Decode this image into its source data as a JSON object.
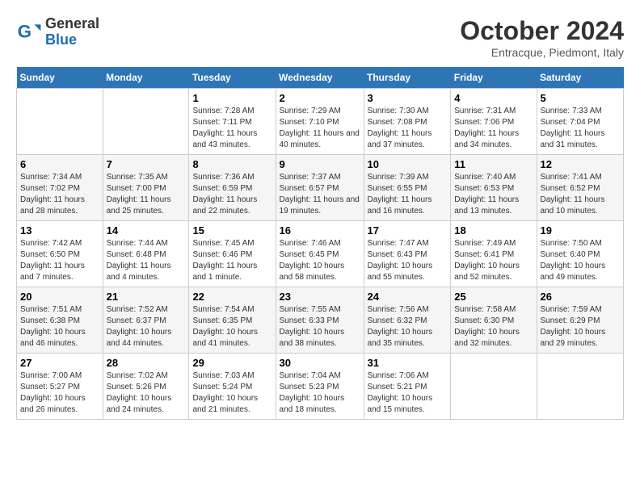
{
  "logo": {
    "general": "General",
    "blue": "Blue"
  },
  "title": "October 2024",
  "subtitle": "Entracque, Piedmont, Italy",
  "days_of_week": [
    "Sunday",
    "Monday",
    "Tuesday",
    "Wednesday",
    "Thursday",
    "Friday",
    "Saturday"
  ],
  "weeks": [
    [
      {
        "day": "",
        "info": ""
      },
      {
        "day": "",
        "info": ""
      },
      {
        "day": "1",
        "info": "Sunrise: 7:28 AM\nSunset: 7:11 PM\nDaylight: 11 hours and 43 minutes."
      },
      {
        "day": "2",
        "info": "Sunrise: 7:29 AM\nSunset: 7:10 PM\nDaylight: 11 hours and 40 minutes."
      },
      {
        "day": "3",
        "info": "Sunrise: 7:30 AM\nSunset: 7:08 PM\nDaylight: 11 hours and 37 minutes."
      },
      {
        "day": "4",
        "info": "Sunrise: 7:31 AM\nSunset: 7:06 PM\nDaylight: 11 hours and 34 minutes."
      },
      {
        "day": "5",
        "info": "Sunrise: 7:33 AM\nSunset: 7:04 PM\nDaylight: 11 hours and 31 minutes."
      }
    ],
    [
      {
        "day": "6",
        "info": "Sunrise: 7:34 AM\nSunset: 7:02 PM\nDaylight: 11 hours and 28 minutes."
      },
      {
        "day": "7",
        "info": "Sunrise: 7:35 AM\nSunset: 7:00 PM\nDaylight: 11 hours and 25 minutes."
      },
      {
        "day": "8",
        "info": "Sunrise: 7:36 AM\nSunset: 6:59 PM\nDaylight: 11 hours and 22 minutes."
      },
      {
        "day": "9",
        "info": "Sunrise: 7:37 AM\nSunset: 6:57 PM\nDaylight: 11 hours and 19 minutes."
      },
      {
        "day": "10",
        "info": "Sunrise: 7:39 AM\nSunset: 6:55 PM\nDaylight: 11 hours and 16 minutes."
      },
      {
        "day": "11",
        "info": "Sunrise: 7:40 AM\nSunset: 6:53 PM\nDaylight: 11 hours and 13 minutes."
      },
      {
        "day": "12",
        "info": "Sunrise: 7:41 AM\nSunset: 6:52 PM\nDaylight: 11 hours and 10 minutes."
      }
    ],
    [
      {
        "day": "13",
        "info": "Sunrise: 7:42 AM\nSunset: 6:50 PM\nDaylight: 11 hours and 7 minutes."
      },
      {
        "day": "14",
        "info": "Sunrise: 7:44 AM\nSunset: 6:48 PM\nDaylight: 11 hours and 4 minutes."
      },
      {
        "day": "15",
        "info": "Sunrise: 7:45 AM\nSunset: 6:46 PM\nDaylight: 11 hours and 1 minute."
      },
      {
        "day": "16",
        "info": "Sunrise: 7:46 AM\nSunset: 6:45 PM\nDaylight: 10 hours and 58 minutes."
      },
      {
        "day": "17",
        "info": "Sunrise: 7:47 AM\nSunset: 6:43 PM\nDaylight: 10 hours and 55 minutes."
      },
      {
        "day": "18",
        "info": "Sunrise: 7:49 AM\nSunset: 6:41 PM\nDaylight: 10 hours and 52 minutes."
      },
      {
        "day": "19",
        "info": "Sunrise: 7:50 AM\nSunset: 6:40 PM\nDaylight: 10 hours and 49 minutes."
      }
    ],
    [
      {
        "day": "20",
        "info": "Sunrise: 7:51 AM\nSunset: 6:38 PM\nDaylight: 10 hours and 46 minutes."
      },
      {
        "day": "21",
        "info": "Sunrise: 7:52 AM\nSunset: 6:37 PM\nDaylight: 10 hours and 44 minutes."
      },
      {
        "day": "22",
        "info": "Sunrise: 7:54 AM\nSunset: 6:35 PM\nDaylight: 10 hours and 41 minutes."
      },
      {
        "day": "23",
        "info": "Sunrise: 7:55 AM\nSunset: 6:33 PM\nDaylight: 10 hours and 38 minutes."
      },
      {
        "day": "24",
        "info": "Sunrise: 7:56 AM\nSunset: 6:32 PM\nDaylight: 10 hours and 35 minutes."
      },
      {
        "day": "25",
        "info": "Sunrise: 7:58 AM\nSunset: 6:30 PM\nDaylight: 10 hours and 32 minutes."
      },
      {
        "day": "26",
        "info": "Sunrise: 7:59 AM\nSunset: 6:29 PM\nDaylight: 10 hours and 29 minutes."
      }
    ],
    [
      {
        "day": "27",
        "info": "Sunrise: 7:00 AM\nSunset: 5:27 PM\nDaylight: 10 hours and 26 minutes."
      },
      {
        "day": "28",
        "info": "Sunrise: 7:02 AM\nSunset: 5:26 PM\nDaylight: 10 hours and 24 minutes."
      },
      {
        "day": "29",
        "info": "Sunrise: 7:03 AM\nSunset: 5:24 PM\nDaylight: 10 hours and 21 minutes."
      },
      {
        "day": "30",
        "info": "Sunrise: 7:04 AM\nSunset: 5:23 PM\nDaylight: 10 hours and 18 minutes."
      },
      {
        "day": "31",
        "info": "Sunrise: 7:06 AM\nSunset: 5:21 PM\nDaylight: 10 hours and 15 minutes."
      },
      {
        "day": "",
        "info": ""
      },
      {
        "day": "",
        "info": ""
      }
    ]
  ]
}
